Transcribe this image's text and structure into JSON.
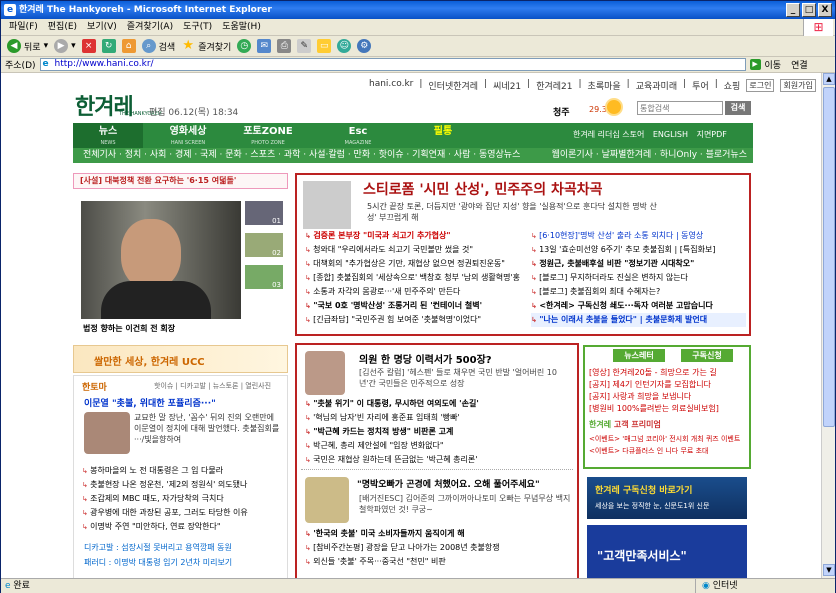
{
  "window": {
    "title": "한겨레 The Hankyoreh - Microsoft Internet Explorer",
    "min": "_",
    "max": "□",
    "close": "X"
  },
  "menu": [
    "파일(F)",
    "편집(E)",
    "보기(V)",
    "즐겨찾기(A)",
    "도구(T)",
    "도움말(H)"
  ],
  "toolbar": {
    "back": "뒤로",
    "search": "검색",
    "favorites": "즐겨찾기"
  },
  "address": {
    "label": "주소(D)",
    "url": "http://www.hani.co.kr/",
    "go": "이동",
    "links": "연결"
  },
  "topnav": [
    "hani.co.kr",
    "인터넷한겨레",
    "씨네21",
    "한겨레21",
    "초록마을",
    "교육과미래",
    "투어",
    "쇼핑"
  ],
  "login": "로그인",
  "join": "회원가입",
  "logo": "한겨레",
  "logo_sub": "THE HANKYOREH",
  "edition": "편집 06.12(목) 18:34",
  "weather": {
    "city": "청주",
    "temp": "29.3"
  },
  "search": {
    "placeholder": "통합검색",
    "button": "검색"
  },
  "tabs": [
    {
      "label": "뉴스",
      "sub": "NEWS"
    },
    {
      "label": "영화세상",
      "sub": "HANI SCREEN"
    },
    {
      "label": "포토ZONE",
      "sub": "PHOTO ZONE"
    },
    {
      "label": "Esc",
      "sub": "MAGAZINE"
    }
  ],
  "ucc_tab": "필통",
  "tab_links": [
    "한겨레 리더십 스토어",
    "ENGLISH",
    "지면PDF"
  ],
  "subnav": "전체기사 · 정치 · 사회 · 경제 · 국제 · 문화 · 스포츠 · 과학 · 사설·칼럼 · 만화 · 핫이슈 · 기획연재 · 사람 · 동영상뉴스",
  "subnav_right": "웹이론기사 · 날짜별한겨레 · 하니Only · 블로거뉴스",
  "editorial": "[사설] 대북정책 전환 요구하는 '6·15 여덟돌'",
  "photo_caption": "법정 향하는 이건희 전 회장",
  "thumb_nums": [
    "01",
    "02",
    "03"
  ],
  "headline": "스티로폼 '시민 산성', 민주주의 차곡차곡",
  "lead": "5시간 끝장 토론, 더듬지만 '광야와 집단 지성' 향을 '실용적'으로 훈다닥 설치한 명박 산성' 부끄럽게 해",
  "left_items": [
    "검증론 본부장 \"미국과 쇠고기 추가협상\"",
    "청와대 \"우리에서라도 쇠고기 국민볼만 썼을 것\"",
    "대책회의 \"추가협상은 기만, 재협상 없으면 정권퇴진운동\"",
    "[종합] 촛불집회의 '세상속으로' 백창호 청부 '남의 생활혁명'홍",
    "소통과 자각의 몸광로···'새 민주주의' 만든다",
    "\"국보 0호 '명박산성' 조롱거리 된 '컨테이너 철벽'",
    "[긴급좌담] \"국민주권 힘 보여준 '촛불혁명'이었다\""
  ],
  "right_items": [
    "[6·10현장]'명박 산성' 출라 소통 외치다 | 동영상",
    "13일 '효순미선양 6주기' 추모 촛불집회 | [특집화보]",
    "정원근, 촛불배후설 비판 \"정보기관 시대착오\"",
    "[블로그] 무지하더라도 진실은 변하지 않는다",
    "[블로그] 촛불집회의 최대 수혜자는?",
    "<한겨레> 구독신청 쇄도···독자 여러분 고맙습니다",
    "\"나는 이래서 촛불을 들었다\" | 촛불문화제 발언대"
  ],
  "ucc_banner": "쌀만한 세상, 한겨레 UCC",
  "tdoma": {
    "title": "한토마",
    "tabs": [
      "핫이슈",
      "디카고발",
      "뉴스토론",
      "열린사진"
    ]
  },
  "tdoma_head": "이문열 \"촛불, 위대한 포퓰리즘···\"",
  "tdoma_desc": "교묘한 말 장난, '꼼수' 뒤의 진의 오랜만에 이문열이 정치에 대해 발언했다. 촛불집회를 ···/빛을향하여",
  "tdoma_list": [
    "봉하마을의 노 전 대통령은 그 입 다물라",
    "촛불현장 나온 정운천, '제2의 정원식' 의도됐나",
    "조갑제의 MBC 때도, 자가당착의 극치다",
    "광우병에 대한 과장된 공포, 그러도 타당한 이유",
    "이명박 주연 \"미안하다, 연료 장악한다\""
  ],
  "digi": "디카고발 : 섬장시절 못버리고 용역깡패 동원",
  "parody": "패러디 : 이명박 대통령 임기 2년차 미리보기",
  "mid_head1": "의원 한 명당 이력서가 500장?",
  "mid_desc1": "[김선주 칼럼] '헤스펜' 들로 채우면 국민 반발 '얼어버린 10년'간 국민들은 민주적으로 성장",
  "mid_list1": [
    "\"촛불 위기\" 이 대통령, 무시하던 여의도에 '손길'",
    "'혁님의 남자'빈 자리에 홍준표 임태희 '빵빠'",
    "\"박근혜 카드는 정치적 방생\" 비판론 고계",
    "박근혜, 총리 제안설에 \"입장 변화없다\"",
    "국민은 재협상 원하는데 뜬금없는 '박근혜 총리론'"
  ],
  "mid_head2": "\"명박오빠가 곤경에 처했어요. 오해 풀어주세요\"",
  "mid_desc2": "[배거진ESC] 김어준의 그까이꺼아나토미 오빠는 무념무상 백지철학파였던 것! 쿠궁~",
  "mid_list2": [
    "'한국의 촛불' 미국 소비자들까지 움직이게 해",
    "[참비주간논평] 광장을 닫고 나아가는 2008년 촛불항쟁",
    "외신들 '촛불' 주목···중국선 \"천민\" 비판"
  ],
  "news_letter": "뉴스레터",
  "subscribe": "구독신청",
  "notices": [
    "[영상] 한겨레20돌 - 희망으로 가는 길",
    "[공지] 제4기 인턴기자를 모집합니다",
    "[공지] 사랑과 희망을 보냅니다",
    "[병원비 100%를려받는 의료실비보험]"
  ],
  "biz_tabs": [
    "한겨레",
    "고객",
    "프리미엄"
  ],
  "events": [
    "<이벤트> '매그넘 코리아' 전시회 개최 퀴즈 이벤트",
    "<이벤트> 다큐플러스 인 니다 무료 초대"
  ],
  "ad1": "한겨레 구독신청 바로가기",
  "ad1_sub": "세상을 보는 정직한 눈, 신문도1위 신문",
  "ad2": "\"고객만족서비스\"",
  "status": {
    "text": "완료",
    "zone": "인터넷"
  }
}
